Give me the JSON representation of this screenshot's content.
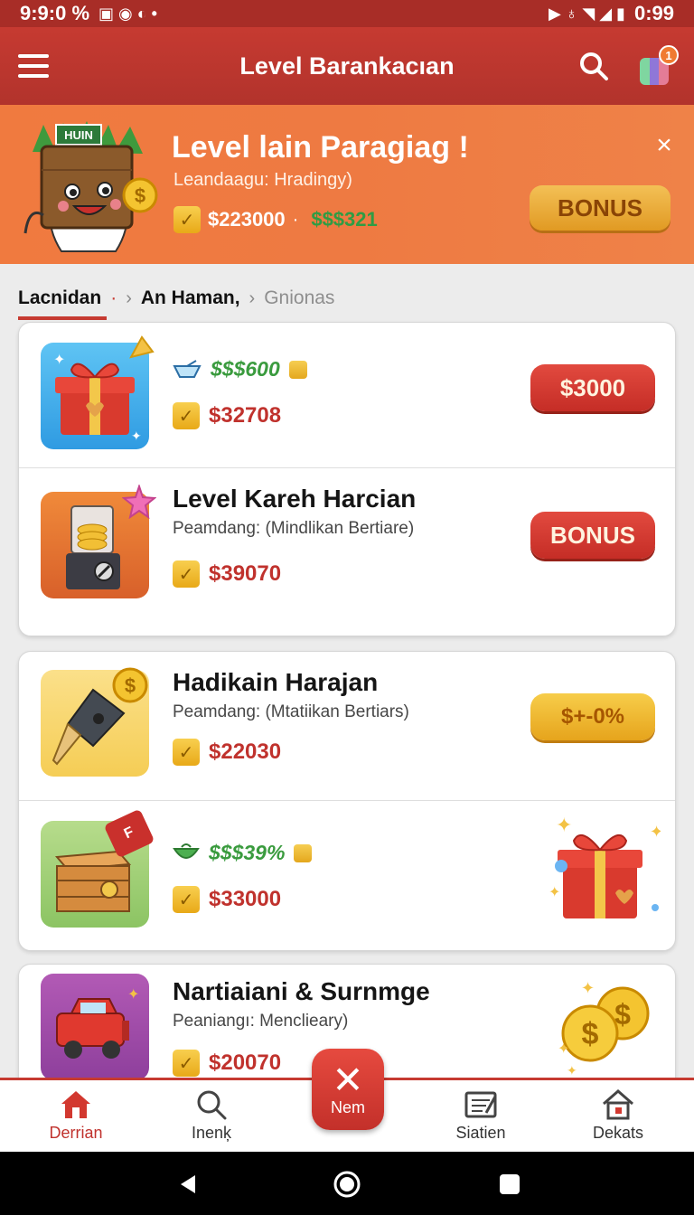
{
  "status_bar": {
    "time": "9:9:0 %",
    "battery_time": "0:99"
  },
  "app_bar": {
    "title": "Level Barankacıan",
    "gift_badge": "1"
  },
  "banner": {
    "title": "Level lain Paragiag !",
    "subtitle": "Leandaagu: Hradingy)",
    "box_label": "HUIN",
    "amount": "$223000",
    "amount_green": "$$$321",
    "bonus_label": "BONUS",
    "close_label": "×"
  },
  "breadcrumb": {
    "item1": "Lacnidan",
    "item2": "An Haman,",
    "item3": "Gnionas"
  },
  "cards": {
    "row1": {
      "green_text": "$$$600",
      "price": "$32708",
      "button": "$3000"
    },
    "row2": {
      "title": "Level Kareh Harcian",
      "subtitle": "Peamdang: (Mindlikan Bertiare)",
      "price": "$39070",
      "button": "BONUS"
    },
    "row3": {
      "title": "Hadikain Harajan",
      "subtitle": "Peamdang: (Mtatiikan Bertiars)",
      "price": "$22030",
      "button": "$+-0%"
    },
    "row4": {
      "green_text": "$$$39%",
      "price": "$33000",
      "ribbon": "F"
    },
    "row5": {
      "title": "Nartiaiani & Surnmge",
      "subtitle": "Peaniangı: Mencliеary)",
      "price": "$20070"
    }
  },
  "bottom_nav": {
    "home": "Derrian",
    "search": "Inenķ",
    "fab": "Nem",
    "stats": "Siatien",
    "deals": "Dekats"
  },
  "colors": {
    "primary": "#c63a31",
    "banner": "#f07a3f",
    "gold": "#f3c056",
    "green": "#3a9b3e"
  }
}
